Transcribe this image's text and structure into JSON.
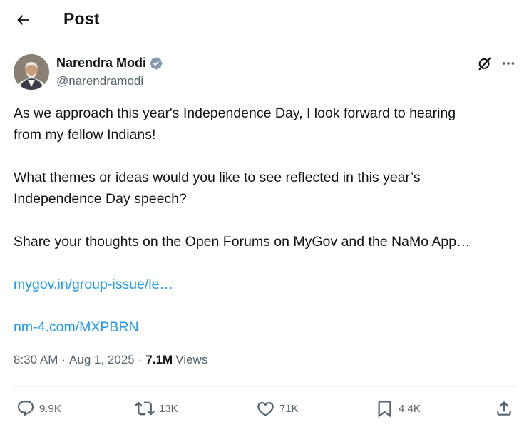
{
  "header": {
    "title": "Post"
  },
  "author": {
    "name": "Narendra Modi",
    "handle": "@narendramodi",
    "verified": true
  },
  "tweet": {
    "paragraph_1_line_1": "As we approach this year's Independence Day, I look forward to hearing",
    "paragraph_1_line_2": "from my fellow Indians!",
    "paragraph_2_line_1": "What themes or ideas would you like to see reflected in this year’s",
    "paragraph_2_line_2": "Independence Day speech?",
    "paragraph_3": "Share your thoughts on the Open Forums on MyGov and the NaMo App…",
    "link_1": "mygov.in/group-issue/le…",
    "link_2": "nm-4.com/MXPBRN"
  },
  "meta": {
    "time": "8:30 AM",
    "date": "Aug 1, 2025",
    "views_count": "7.1M",
    "views_label": "Views"
  },
  "actions": {
    "replies": "9.9K",
    "reposts": "13K",
    "likes": "71K",
    "bookmarks": "4.4K"
  },
  "colors": {
    "text": "#0f1419",
    "secondary": "#536471",
    "link": "#1d9bf0",
    "verified_badge": "#829aab"
  },
  "icons": {
    "back": "arrow-left-icon",
    "verified": "verified-badge-icon",
    "grok": "grok-icon",
    "more": "more-dots-icon",
    "reply": "reply-icon",
    "repost": "repost-icon",
    "like": "heart-icon",
    "bookmark": "bookmark-icon",
    "share": "share-icon"
  }
}
